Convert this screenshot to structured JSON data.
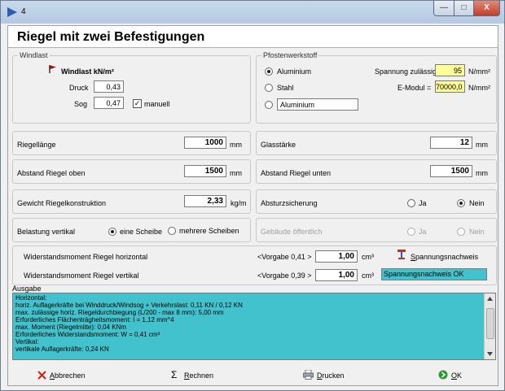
{
  "window": {
    "title": "4",
    "min_glyph": "—",
    "max_glyph": "□",
    "close_glyph": "X"
  },
  "header": {
    "title": "Riegel mit zwei Befestigungen"
  },
  "windlast": {
    "legend": "Windlast",
    "heading": "Windlast kN/m²",
    "druck_label": "Druck",
    "druck_value": "0,43",
    "sog_label": "Sog",
    "sog_value": "0,47",
    "manuell_label": "manuell",
    "manuell_checked": true
  },
  "pfosten": {
    "legend": "Pfostenwerkstoff",
    "options": [
      "Aluminium",
      "Stahl"
    ],
    "selected": "Aluminium",
    "custom_value": "Aluminium",
    "spannung_label": "Spannung zulässig=",
    "spannung_value": "95",
    "spannung_unit": "N/mm²",
    "emodul_label": "E-Modul =",
    "emodul_value": "70000,0",
    "emodul_unit": "N/mm²"
  },
  "fields": {
    "riegellaenge": {
      "label": "Riegellänge",
      "value": "1000",
      "unit": "mm"
    },
    "glasstaerke": {
      "label": "Glasstärke",
      "value": "12",
      "unit": "mm"
    },
    "abstand_oben": {
      "label": "Abstand Riegel oben",
      "value": "1500",
      "unit": "mm"
    },
    "abstand_unten": {
      "label": "Abstand  Riegel unten",
      "value": "1500",
      "unit": "mm"
    },
    "gewicht": {
      "label": "Gewicht Riegelkonstruktion",
      "value": "2,33",
      "unit": "kg/m"
    }
  },
  "absturz": {
    "label": "Absturzsicherung",
    "ja": "Ja",
    "nein": "Nein",
    "selected": "Nein"
  },
  "belastung": {
    "label": "Belastung vertikal",
    "opt1": "eine Scheibe",
    "opt2": "mehrere Scheiben",
    "selected": "eine Scheibe"
  },
  "gebaeude": {
    "label": "Gebäude öffentlich",
    "ja": "Ja",
    "nein": "Nein"
  },
  "widerstand": {
    "horiz_label": "Widerstandsmoment Riegel horizontal",
    "horiz_vorgabe": "<Vorgabe 0,41 >",
    "horiz_value": "1,00",
    "vert_label": "Widerstandsmoment Riegel vertikal",
    "vert_vorgabe": "<Vorgabe 0,39 >",
    "vert_value": "1,00",
    "unit": "cm³",
    "nachweis_button": "Spannungsnachweis",
    "nachweis_status": "Spannungsnachweis OK"
  },
  "ausgabe": {
    "label": "Ausgabe",
    "lines": [
      "Horizontal:",
      "horiz. Auflagerkräfte bei Winddruck/Windsog + Verkehrslast: 0,11 KN / 0,12 KN",
      "max. zulässige horiz. Riegeldurchbiegung (L/200 - max 8 mm): 5,00 mm",
      "Erforderliches Flächenträgheitsmoment: I = 1,12 mm^4",
      "max. Moment (Riegelmitte): 0,04 KNm",
      "Erforderliches Widerstandsmoment: W = 0,41 cm³",
      "Vertikal:",
      "vertikale Auflagerkräfte: 0,24 KN"
    ]
  },
  "footer": {
    "abbrechen": "Abbrechen",
    "rechnen": "Rechnen",
    "drucken": "Drucken",
    "ok": "OK"
  },
  "colors": {
    "output_bg": "#42c2cc",
    "highlight": "#ffff99",
    "status_bg": "#42c2cc"
  }
}
